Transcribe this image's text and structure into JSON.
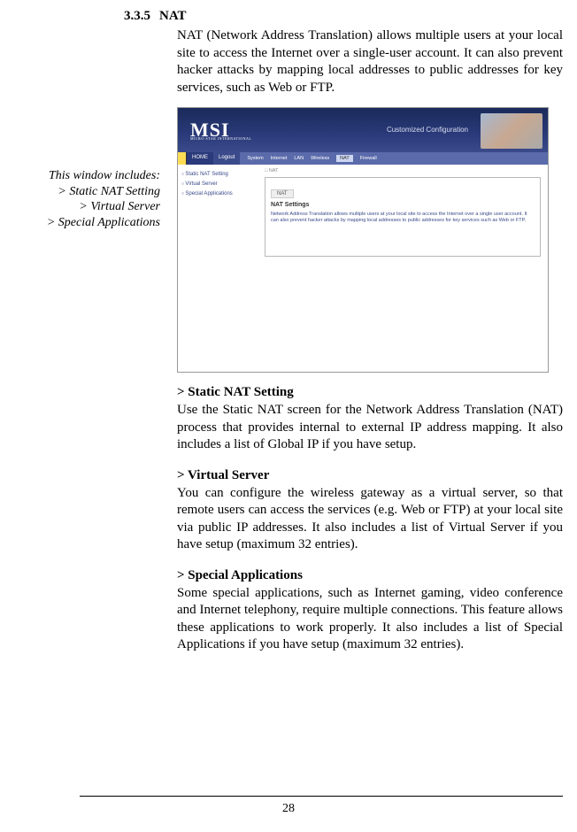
{
  "section": {
    "number": "3.3.5",
    "title": "NAT",
    "intro": "NAT (Network Address Translation) allows multiple users at your local site to access the Internet over a single-user account. It can also prevent hacker attacks by mapping local addresses to public addresses for key services, such as Web or FTP."
  },
  "sidebar": {
    "heading": "This window includes:",
    "items": [
      "> Static NAT Setting",
      "> Virtual Server",
      "> Special Applications"
    ]
  },
  "screenshot": {
    "logo": "MSI",
    "logo_sub": "MICRO-STAR INTERNATIONAL",
    "header_label": "Customized Configuration",
    "nav_home": "HOME",
    "nav_logout": "Logout",
    "nav_tabs": [
      "System",
      "Internet",
      "LAN",
      "Wireless",
      "NAT",
      "Firewall"
    ],
    "nav_active": "NAT",
    "side_items": [
      "Static NAT Setting",
      "Virtual Server",
      "Special Applications"
    ],
    "breadcrumb": "NAT",
    "panel_tab": "NAT",
    "panel_title": "NAT Settings",
    "panel_text": "Network Address Translation allows multiple users at your local site to access the Internet over a single user account. It can also prevent hacker attacks by mapping local addresses to public addresses for key services such as Web or FTP."
  },
  "subsections": [
    {
      "heading": "> Static NAT Setting",
      "text": "Use the Static NAT screen for the Network Address Translation (NAT) process that provides internal to external IP address mapping. It also includes a list of Global IP if you have setup."
    },
    {
      "heading": "> Virtual Server",
      "text": "You can configure the wireless gateway as a virtual server, so that remote users can access the services (e.g. Web or FTP) at your local site via public IP addresses.  It also includes a list of Virtual Server if you have setup (maximum 32 entries)."
    },
    {
      "heading": "> Special Applications",
      "text": "Some special applications, such as Internet gaming, video con­ference and Internet telephony, require multiple connections. This feature allows these applications to work properly.  It also includes a list of Special Applications if you have setup (maximum 32 entries)."
    }
  ],
  "page_number": "28"
}
